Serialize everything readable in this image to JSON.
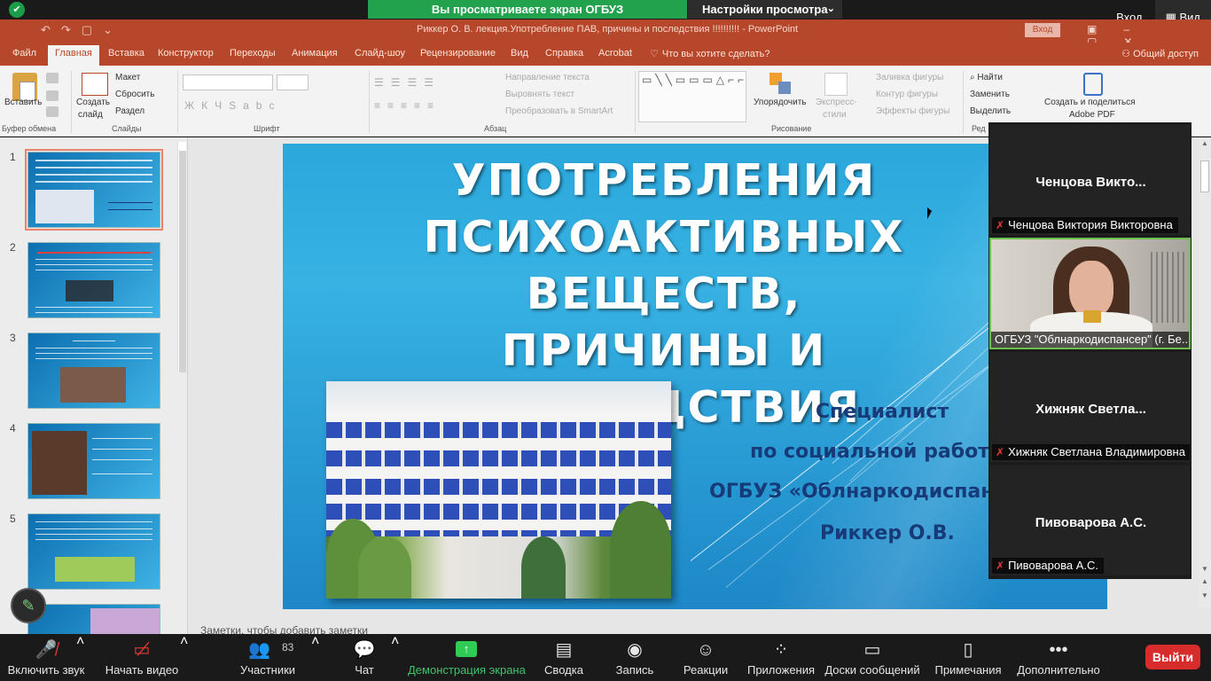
{
  "zoom_top": {
    "share_banner": "Вы просматриваете экран ОГБУЗ \"Облнаркодиспансер\"",
    "view_settings": "Настройки просмотра",
    "enter": "Вход",
    "view": "Вид"
  },
  "ppt_titlebar": {
    "title": "Риккер О. В. лекция.Употребление ПАВ, причины и последствия  !!!!!!!!!!  -  PowerPoint",
    "login": "Вход"
  },
  "ribbon_tabs": [
    "Файл",
    "Главная",
    "Вставка",
    "Конструктор",
    "Переходы",
    "Анимация",
    "Слайд-шоу",
    "Рецензирование",
    "Вид",
    "Справка",
    "Acrobat"
  ],
  "ribbon_tellme": "Что вы хотите сделать?",
  "ribbon_share": "Общий доступ",
  "ribbon": {
    "paste": "Вставить",
    "new_slide_1": "Создать",
    "new_slide_2": "слайд",
    "layout": "Макет",
    "reset": "Сбросить",
    "section": "Раздел",
    "text_direction": "Направление текста",
    "align_text": "Выровнять текст",
    "smartart": "Преобразовать в SmartArt",
    "arrange": "Упорядочить",
    "express_1": "Экспресс-",
    "express_2": "стили",
    "shape_fill": "Заливка фигуры",
    "shape_outline": "Контур фигуры",
    "shape_effects": "Эффекты фигуры",
    "find": "Найти",
    "replace": "Заменить",
    "select": "Выделить",
    "adobe_1": "Создать и поделиться",
    "adobe_2": "Adobe PDF",
    "group_clipboard": "Буфер обмена",
    "group_slides": "Слайды",
    "group_font": "Шрифт",
    "group_paragraph": "Абзац",
    "group_drawing": "Рисование",
    "group_edit": "Ред"
  },
  "thumbnails": [
    {
      "num": "1"
    },
    {
      "num": "2"
    },
    {
      "num": "3"
    },
    {
      "num": "4"
    },
    {
      "num": "5"
    }
  ],
  "slide": {
    "title_lines": [
      "УПОТРЕБЛЕНИЯ",
      "ПСИХОАКТИВНЫХ ВЕЩЕСТВ,",
      "ПРИЧИНЫ И",
      "ПОСЛЕДСТВИЯ"
    ],
    "subtitle_lines": [
      "Специалист",
      "по социальной работе",
      "ОГБУЗ «Облнаркодиспансер»",
      "Риккер О.В."
    ]
  },
  "notes_placeholder": "Заметки, чтобы добавить заметки",
  "participants": [
    {
      "big_name": "Ченцова  Викто...",
      "caption": "Ченцова Виктория Викторовна",
      "video": false
    },
    {
      "big_name": "",
      "caption": "ОГБУЗ \"Облнаркодиспансер\" (г. Бе...",
      "video": true
    },
    {
      "big_name": "Хижняк  Светла...",
      "caption": "Хижняк Светлана Владимировна",
      "video": false
    },
    {
      "big_name": "Пивоварова А.С.",
      "caption": "Пивоварова А.С.",
      "video": false
    }
  ],
  "toolbar": {
    "unmute": "Включить звук",
    "start_video": "Начать видео",
    "participants": "Участники",
    "participants_count": "83",
    "chat": "Чат",
    "share_screen": "Демонстрация экрана",
    "summary": "Сводка",
    "record": "Запись",
    "reactions": "Реакции",
    "apps": "Приложения",
    "whiteboards": "Доски сообщений",
    "notes": "Примечания",
    "more": "Дополнительно",
    "exit": "Выйти"
  },
  "colors": {
    "ppt_red": "#b7472a",
    "zoom_green": "#23a24d",
    "exit_red": "#d82c2c",
    "slide_blue": "#2ba7dc",
    "subtitle_navy": "#173a78"
  },
  "icons": [
    "shield-icon",
    "mic-off-icon",
    "video-off-icon",
    "participants-icon",
    "chat-icon",
    "share-screen-icon",
    "summary-icon",
    "record-icon",
    "reactions-icon",
    "apps-icon",
    "whiteboard-icon",
    "notes-icon",
    "more-icon",
    "pen-icon"
  ]
}
